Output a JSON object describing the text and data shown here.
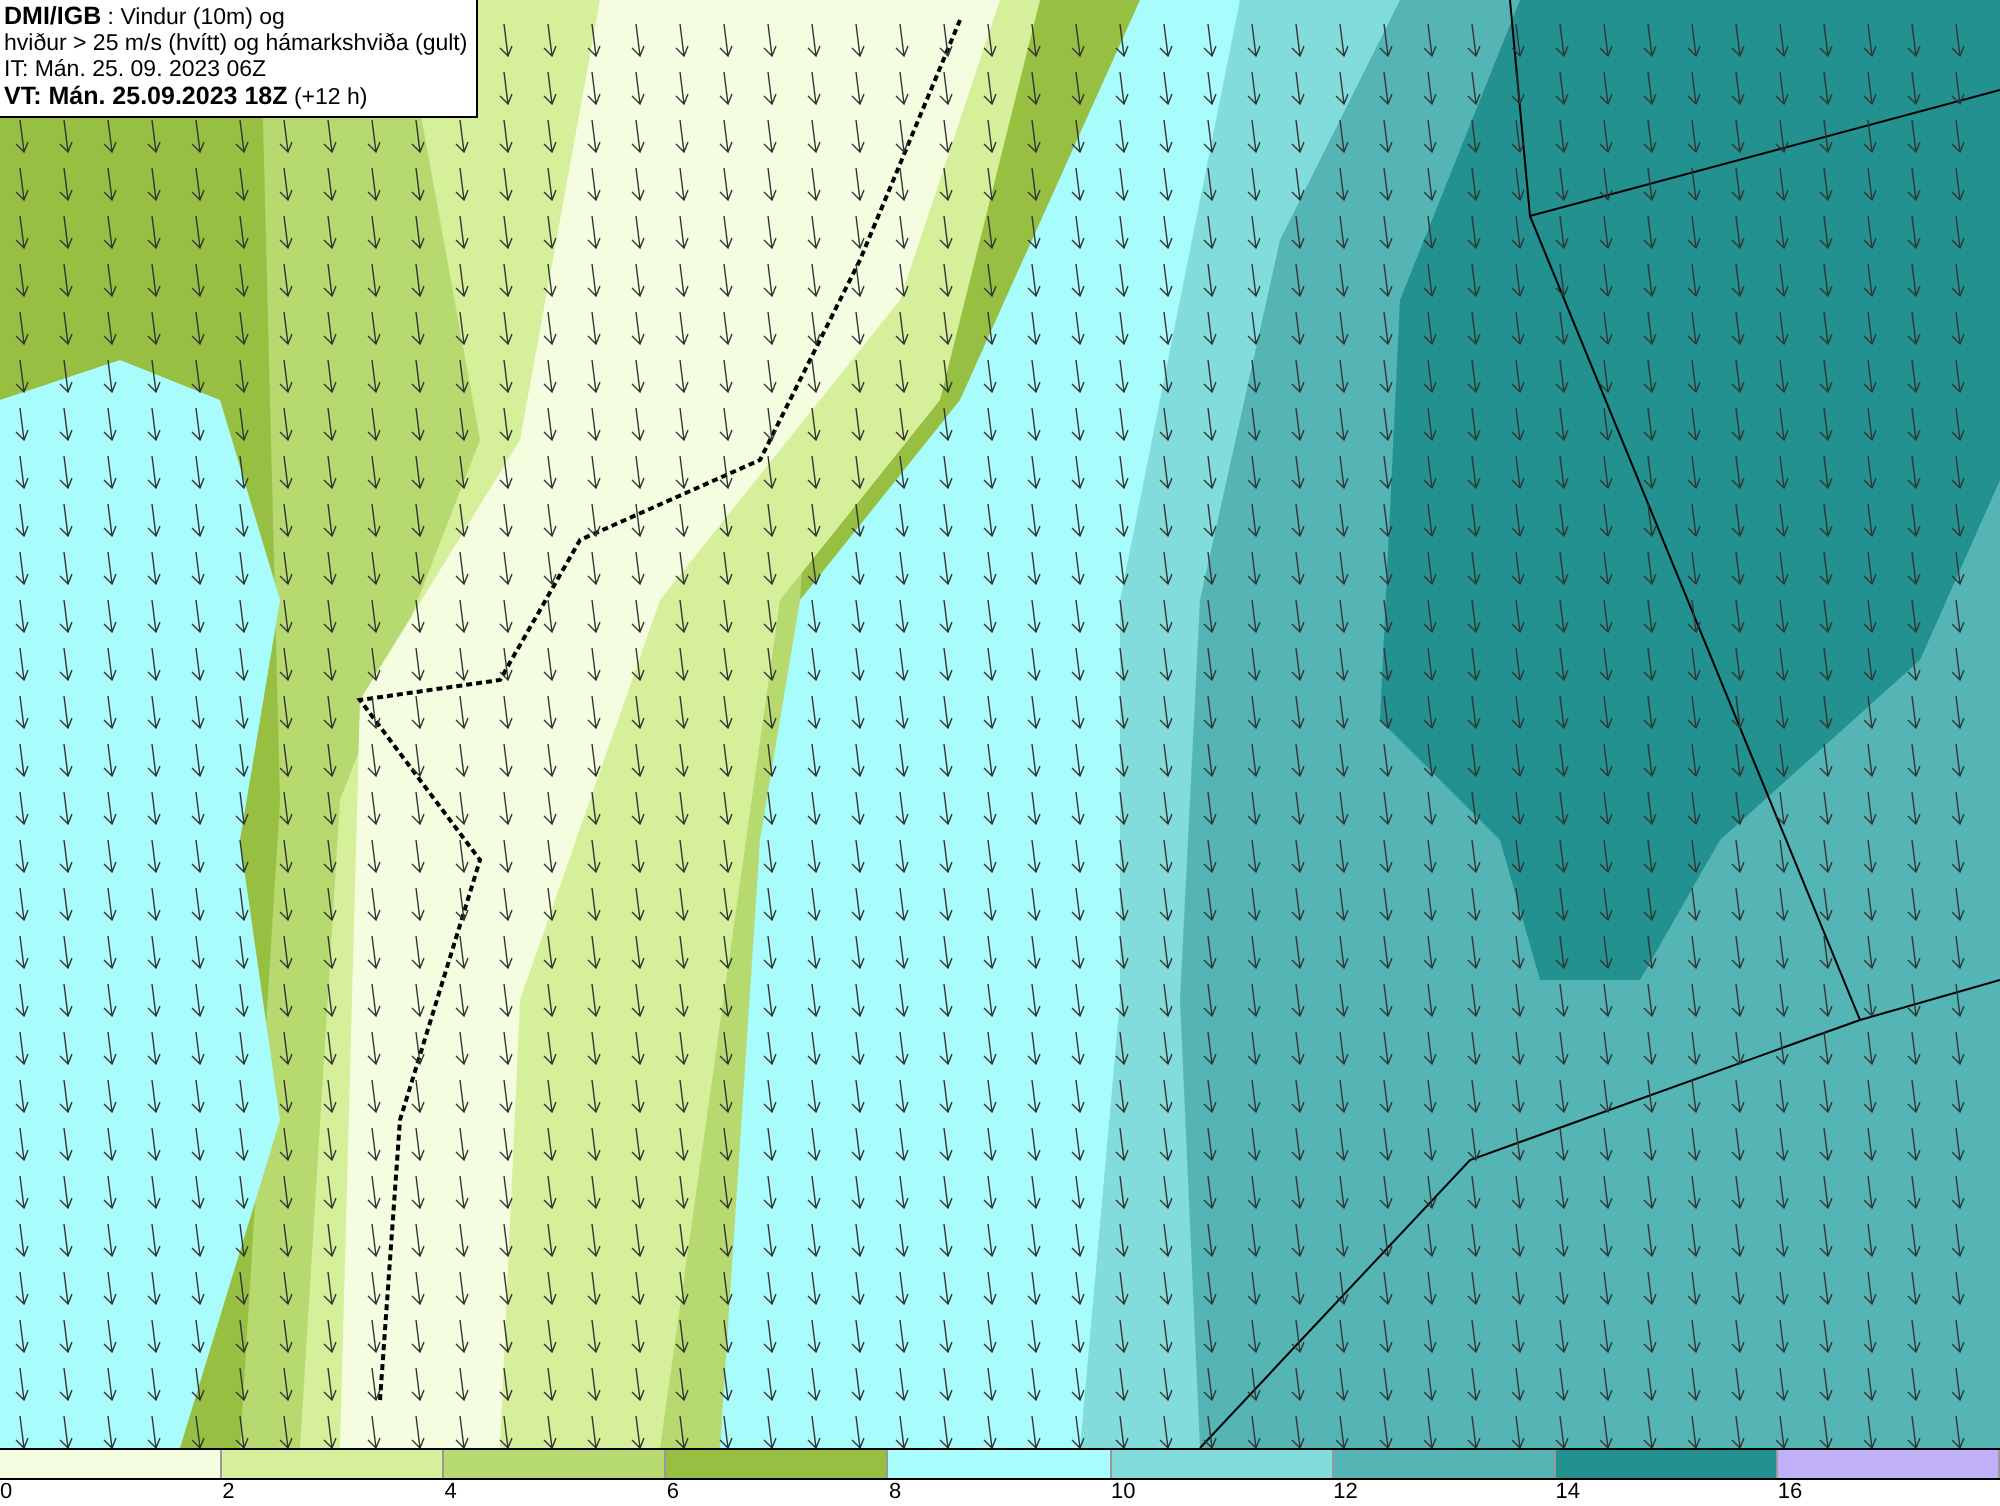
{
  "header": {
    "lines": [
      "**DMI/IGB** : Vindur (10m) og",
      "hviður > 25 m/s (hvítt) og hámarkshviða (gult)",
      "IT: Mán. 25. 09. 2023 06Z",
      "**VT: Mán. 25.09.2023 18Z** (+12 h)"
    ]
  },
  "legend": {
    "bins": [
      {
        "color": "#f5fde0"
      },
      {
        "color": "#d5ef9a"
      },
      {
        "color": "#b6da70"
      },
      {
        "color": "#97c043"
      },
      {
        "color": "#a9fcfc"
      },
      {
        "color": "#82dcdc"
      },
      {
        "color": "#55b5b5"
      },
      {
        "color": "#23918f"
      },
      {
        "color": "#c0b0f8"
      }
    ],
    "ticks": [
      "0",
      "2",
      "4",
      "6",
      "8",
      "10",
      "12",
      "14",
      "16"
    ]
  }
}
